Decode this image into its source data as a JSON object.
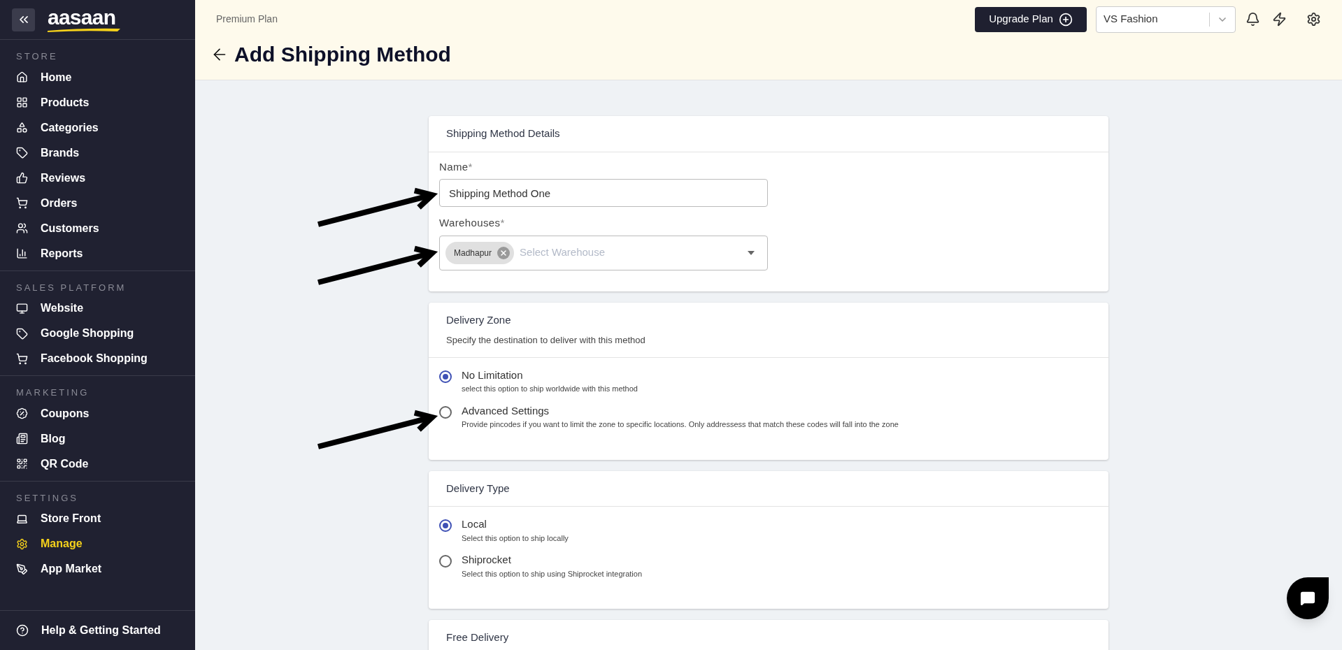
{
  "sidebar": {
    "logo": "aasaan",
    "sections": [
      {
        "title": "STORE",
        "items": [
          {
            "label": "Home",
            "selected": false
          },
          {
            "label": "Products",
            "selected": false
          },
          {
            "label": "Categories",
            "selected": false
          },
          {
            "label": "Brands",
            "selected": false
          },
          {
            "label": "Reviews",
            "selected": false
          },
          {
            "label": "Orders",
            "selected": false
          },
          {
            "label": "Customers",
            "selected": false
          },
          {
            "label": "Reports",
            "selected": false
          }
        ]
      },
      {
        "title": "SALES PLATFORM",
        "items": [
          {
            "label": "Website",
            "selected": false
          },
          {
            "label": "Google Shopping",
            "selected": false
          },
          {
            "label": "Facebook Shopping",
            "selected": false
          }
        ]
      },
      {
        "title": "MARKETING",
        "items": [
          {
            "label": "Coupons",
            "selected": false
          },
          {
            "label": "Blog",
            "selected": false
          },
          {
            "label": "QR Code",
            "selected": false
          }
        ]
      },
      {
        "title": "SETTINGS",
        "items": [
          {
            "label": "Store Front",
            "selected": false
          },
          {
            "label": "Manage",
            "selected": true
          },
          {
            "label": "App Market",
            "selected": false
          }
        ]
      }
    ],
    "footer_item": "Help & Getting Started"
  },
  "header": {
    "plan": "Premium Plan",
    "upgrade_button": "Upgrade Plan",
    "store_select": "VS Fashion",
    "title": "Add Shipping Method"
  },
  "cards": [
    {
      "kind": "fields",
      "title": "Shipping Method Details",
      "name_field": {
        "label": "Name",
        "required": "*",
        "value": "Shipping Method One"
      },
      "warehouse_field": {
        "label": "Warehouses",
        "required": "*",
        "chips": [
          "Madhapur"
        ],
        "placeholder": "Select Warehouse"
      }
    },
    {
      "kind": "radios",
      "title": "Delivery Zone",
      "subtitle": "Specify the destination to deliver with this method",
      "options": [
        {
          "label": "No Limitation",
          "description": "select this option to ship worldwide with this method",
          "selected": true
        },
        {
          "label": "Advanced Settings",
          "description": "Provide pincodes if you want to limit the zone to specific locations. Only addressess that match these codes will fall into the zone",
          "selected": false
        }
      ]
    },
    {
      "kind": "radios",
      "title": "Delivery Type",
      "options": [
        {
          "label": "Local",
          "description": "Select this option to ship locally",
          "selected": true
        },
        {
          "label": "Shiprocket",
          "description": "Select this option to ship using Shiprocket integration",
          "selected": false
        }
      ]
    },
    {
      "kind": "title_only",
      "title": "Free Delivery"
    }
  ]
}
